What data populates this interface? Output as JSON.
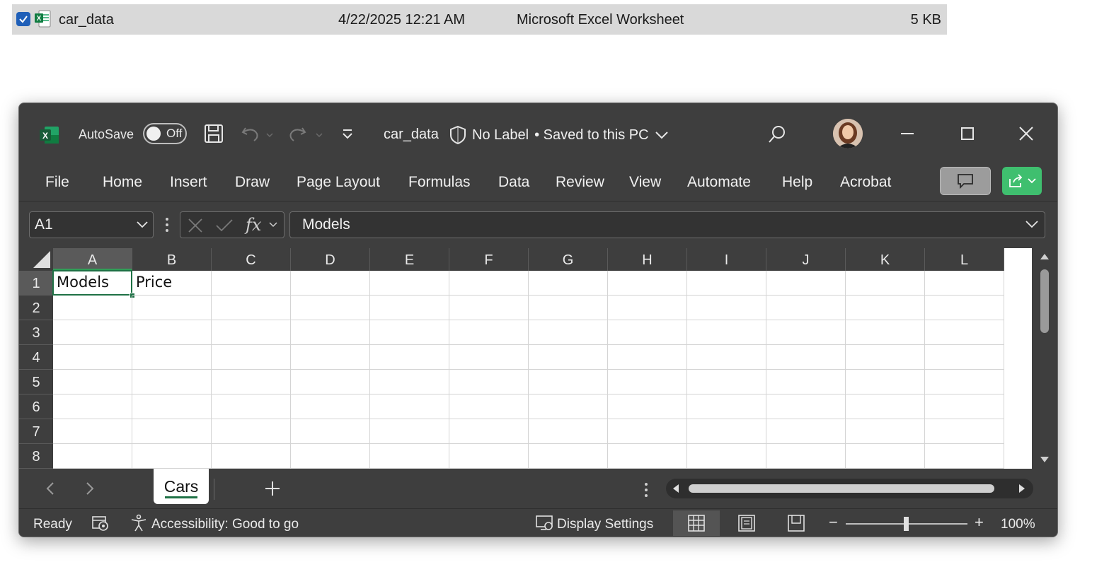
{
  "explorer": {
    "file_name": "car_data",
    "date_modified": "4/22/2025 12:21 AM",
    "type": "Microsoft Excel Worksheet",
    "size": "5 KB"
  },
  "titlebar": {
    "autosave_label": "AutoSave",
    "autosave_state": "Off",
    "document_name": "car_data",
    "sensitivity": "No Label",
    "save_status": "• Saved to this PC"
  },
  "menu": {
    "items": [
      "File",
      "Home",
      "Insert",
      "Draw",
      "Page Layout",
      "Formulas",
      "Data",
      "Review",
      "View",
      "Automate",
      "Help",
      "Acrobat"
    ]
  },
  "formula_bar": {
    "name_box": "A1",
    "content": "Models"
  },
  "grid": {
    "columns": [
      "A",
      "B",
      "C",
      "D",
      "E",
      "F",
      "G",
      "H",
      "I",
      "J",
      "K",
      "L"
    ],
    "rows": [
      "1",
      "2",
      "3",
      "4",
      "5",
      "6",
      "7",
      "8"
    ],
    "cells": {
      "A1": "Models",
      "B1": "Price"
    },
    "active_cell": "A1"
  },
  "sheets": {
    "tabs": [
      "Cars"
    ],
    "active": "Cars"
  },
  "statusbar": {
    "mode": "Ready",
    "accessibility": "Accessibility: Good to go",
    "display_settings": "Display Settings",
    "zoom": "100%",
    "zoom_minus": "−",
    "zoom_plus": "+"
  },
  "colors": {
    "window_bg": "#3e3e3e",
    "accent_green": "#1e7145",
    "share_green": "#3fbf6f",
    "checkbox_blue": "#1f5fb8"
  }
}
